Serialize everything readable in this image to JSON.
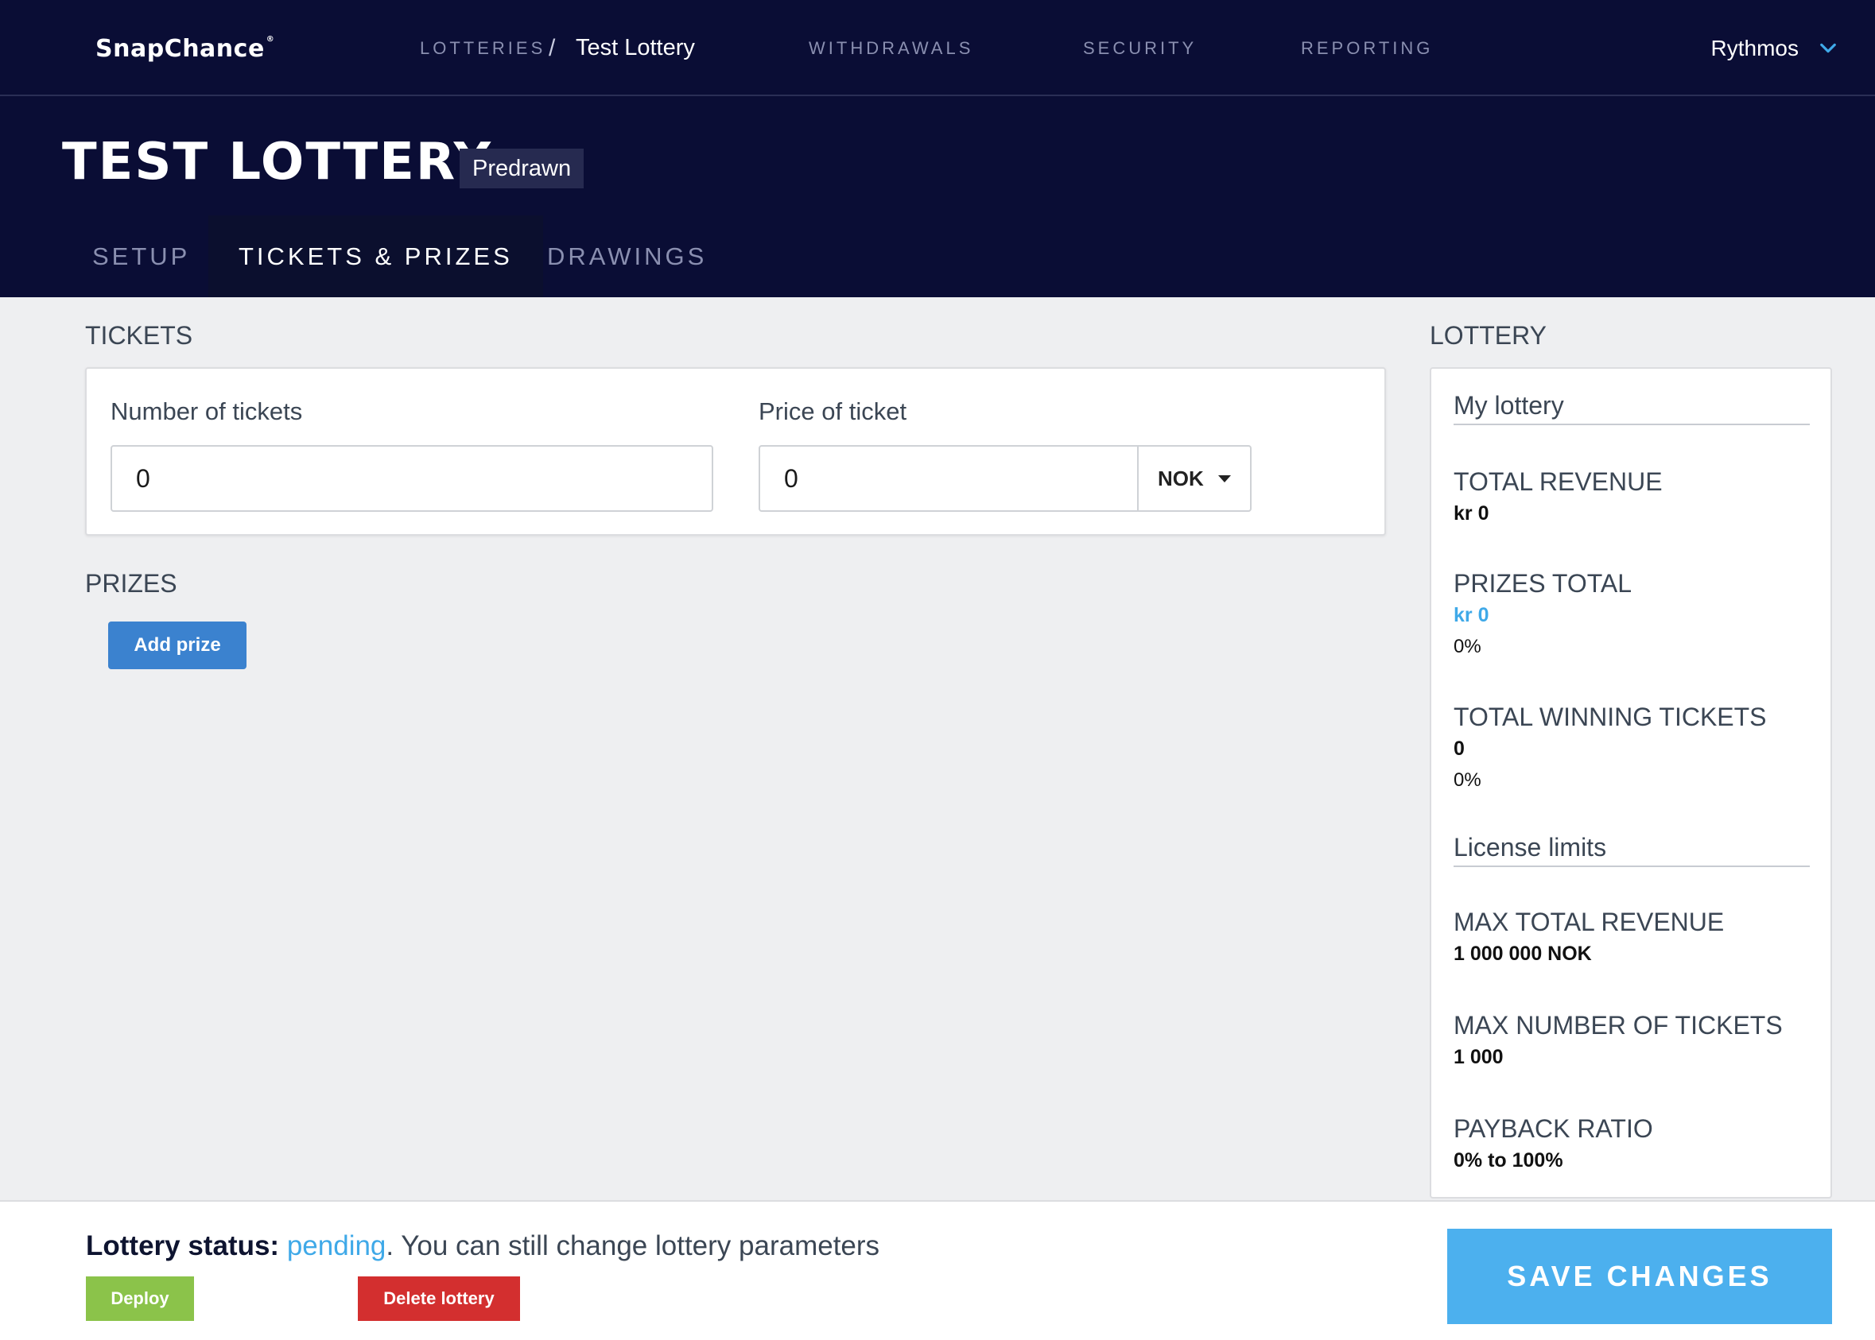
{
  "nav": {
    "logo": "SnapChance",
    "logo_mark": "®",
    "lotteries": "LOTTERIES",
    "separator": "/",
    "current_lottery": "Test Lottery",
    "withdrawals": "WITHDRAWALS",
    "security": "SECURITY",
    "reporting": "REPORTING",
    "user": "Rythmos"
  },
  "header": {
    "title": "TEST LOTTERY",
    "type_badge": "Predrawn",
    "tabs": [
      {
        "label": "SETUP",
        "active": false
      },
      {
        "label": "TICKETS & PRIZES",
        "active": true
      },
      {
        "label": "DRAWINGS",
        "active": false
      }
    ]
  },
  "tickets": {
    "heading": "TICKETS",
    "number_label": "Number of tickets",
    "number_value": "0",
    "price_label": "Price of ticket",
    "price_value": "0",
    "currency": "NOK"
  },
  "prizes": {
    "heading": "PRIZES",
    "add_button": "Add prize"
  },
  "lottery": {
    "heading": "LOTTERY",
    "my_lottery": "My lottery",
    "total_revenue_label": "TOTAL REVENUE",
    "total_revenue_value": "kr 0",
    "prizes_total_label": "PRIZES TOTAL",
    "prizes_total_value": "kr 0",
    "prizes_total_pct": "0%",
    "winning_tickets_label": "TOTAL WINNING TICKETS",
    "winning_tickets_value": "0",
    "winning_tickets_pct": "0%",
    "license_limits": "License limits",
    "max_revenue_label": "MAX TOTAL REVENUE",
    "max_revenue_value": "1 000 000 NOK",
    "max_tickets_label": "MAX NUMBER OF TICKETS",
    "max_tickets_value": "1 000",
    "payback_label": "PAYBACK RATIO",
    "payback_value": "0% to 100%"
  },
  "footer": {
    "status_label": "Lottery status:",
    "status_value": "pending",
    "status_note": ". You can still change lottery parameters",
    "deploy": "Deploy",
    "delete": "Delete lottery",
    "save": "SAVE CHANGES"
  },
  "colors": {
    "nav_bg": "#0a0d35",
    "accent_blue": "#3fa9e8",
    "add_button": "#3b82cf",
    "deploy": "#8bc34a",
    "delete": "#d32f2f",
    "save": "#4cb0ee"
  }
}
